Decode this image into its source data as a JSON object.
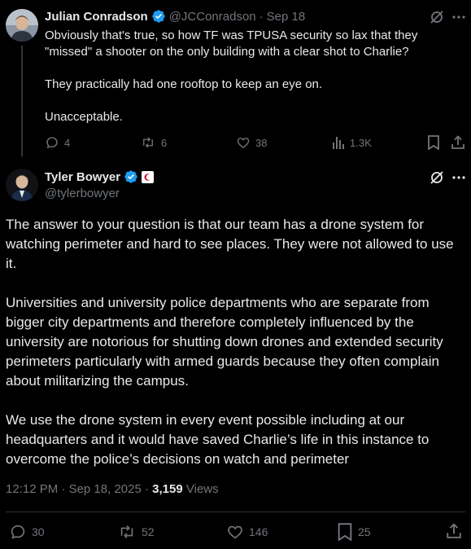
{
  "reply_tweet": {
    "author_name": "Julian Conradson",
    "handle": "@JCConradson",
    "separator": "·",
    "date": "Sep 18",
    "paragraphs": [
      "Obviously that's true, so how TF was TPUSA security so lax that they \"missed\" a shooter on the only building with a clear shot to Charlie?",
      "They practically had one rooftop to keep an eye on.",
      "Unacceptable."
    ],
    "stats": {
      "replies": "4",
      "reposts": "6",
      "likes": "38",
      "views": "1.3K"
    }
  },
  "main_tweet": {
    "author_name": "Tyler Bowyer",
    "handle": "@tylerbowyer",
    "paragraphs": [
      "The answer to your question is that our team has a drone system for watching perimeter and hard to see places. They were not allowed to use it.",
      "Universities and university police departments who are separate from bigger city departments and therefore completely influenced by the university are notorious for shutting down drones and extended security perimeters particularly with armed guards because they often complain about militarizing the campus.",
      "We use the drone system in every event possible including at our headquarters and it would have saved Charlie’s life in this instance to overcome the police’s decisions on watch and perimeter"
    ],
    "time": "12:12 PM",
    "dot": "·",
    "date": "Sep 18, 2025",
    "views_count": "3,159",
    "views_label": "Views",
    "stats": {
      "replies": "30",
      "reposts": "52",
      "likes": "146",
      "bookmarks": "25"
    }
  },
  "colors": {
    "verified": "#1d9bf0",
    "affiliate_badge": "#c8102e",
    "muted": "#71767b"
  },
  "icons": [
    "grok-icon",
    "more-icon",
    "reply-icon",
    "repost-icon",
    "like-icon",
    "views-icon",
    "bookmark-icon",
    "share-icon",
    "verified-icon",
    "affiliate-badge-icon"
  ]
}
